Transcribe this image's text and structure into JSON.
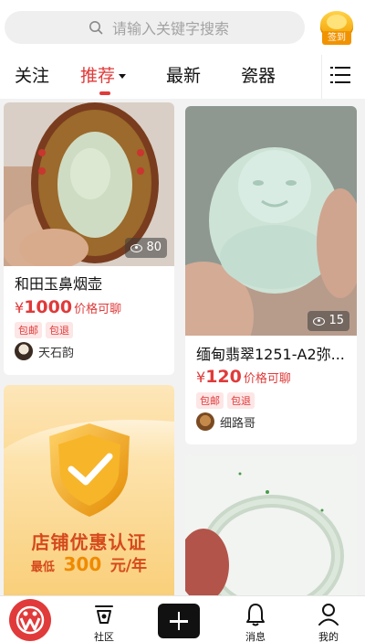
{
  "search": {
    "placeholder": "请输入关键字搜索"
  },
  "signin": {
    "label": "签到"
  },
  "tabs": [
    {
      "label": "关注"
    },
    {
      "label": "推荐"
    },
    {
      "label": "最新"
    },
    {
      "label": "瓷器"
    }
  ],
  "feed": [
    {
      "title": "和田玉鼻烟壶",
      "currency": "¥",
      "price": "1000",
      "price_note": "价格可聊",
      "badges": [
        "包邮",
        "包退"
      ],
      "seller": "天石韵",
      "views": "80"
    },
    {
      "title": "缅甸翡翠1251-A2弥...",
      "currency": "¥",
      "price": "120",
      "price_note": "价格可聊",
      "badges": [
        "包邮",
        "包退"
      ],
      "seller": "细路哥",
      "views": "15"
    },
    {
      "ad_line1": "店铺优惠认证",
      "ad_line2_prefix": "最低",
      "ad_line2_amount": "300",
      "ad_line2_suffix": "元/年"
    }
  ],
  "bottom_nav": {
    "community": "社区",
    "messages": "消息",
    "mine": "我的"
  },
  "colors": {
    "accent": "#e03a3a",
    "ad_orange": "#f6a623"
  }
}
